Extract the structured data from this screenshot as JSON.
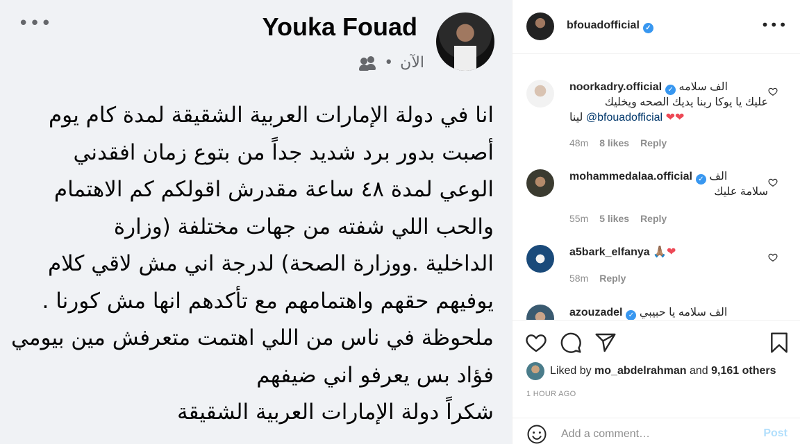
{
  "image_post": {
    "author": "Youka Fouad",
    "time": "الآن",
    "separator": "•",
    "more_icon": "more-horizontal-icon",
    "audience_icon": "friends-icon",
    "body_lines": [
      "انا في دولة الإمارات العربية الشقيقة لمدة كام يوم",
      "أصبت بدور برد شديد جداً من بتوع زمان افقدني",
      "الوعي لمدة ٤٨ ساعة مقدرش اقولكم كم الاهتمام",
      "والحب اللي شفته   من جهات مختلفة (وزارة",
      "الداخلية .ووزارة الصحة) لدرجة اني مش لاقي كلام",
      "يوفيهم  حقهم واهتمامهم مع تأكدهم انها مش كورنا .",
      "ملحوظة في ناس من اللي اهتمت متعرفش مين بيومي",
      "فؤاد بس يعرفو اني ضيفهم",
      "شكراً دولة الإمارات العربية الشقيقة"
    ]
  },
  "header": {
    "username": "bfouadofficial",
    "verified_icon": "verified-badge-icon",
    "more_icon": "more-options-icon"
  },
  "comments": [
    {
      "username": "noorkadry.official",
      "verified": true,
      "line1": "الف سلامه",
      "line2": "عليك يا يوكا ربنا يديك الصحه ويخليك",
      "line3_mention": "@bfouadofficial",
      "line3_text": "لينا",
      "hearts": "❤❤",
      "time": "48m",
      "likes": "8 likes",
      "reply": "Reply"
    },
    {
      "username": "mohammedalaa.official",
      "verified": true,
      "line1": "الف",
      "line2": "سلامة عليك",
      "time": "55m",
      "likes": "5 likes",
      "reply": "Reply"
    },
    {
      "username": "a5bark_elfanya",
      "verified": false,
      "emoji": "🙏🏽❤",
      "time": "58m",
      "reply": "Reply"
    },
    {
      "username": "azouzadel",
      "verified": true,
      "line1": "الف سلامه يا حبيبي"
    }
  ],
  "actions": {
    "like_icon": "heart-icon",
    "comment_icon": "comment-icon",
    "share_icon": "share-icon",
    "save_icon": "bookmark-icon",
    "liked_by_prefix": "Liked by",
    "liked_by_user": "mo_abdelrahman",
    "liked_by_and": "and",
    "liked_by_others": "9,161 others",
    "time_ago": "1 HOUR AGO"
  },
  "add_comment": {
    "emoji_icon": "smiley-icon",
    "placeholder": "Add a comment…",
    "post_label": "Post"
  }
}
